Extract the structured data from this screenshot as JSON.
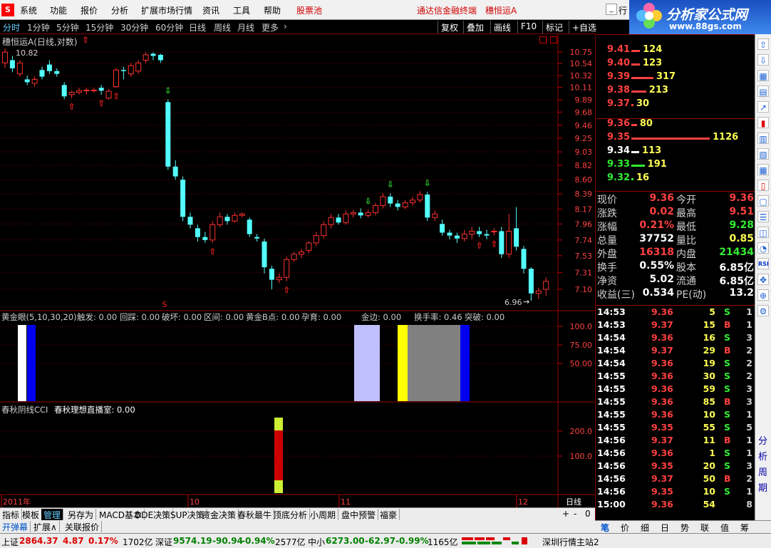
{
  "menu": {
    "logo_letter": "S",
    "items": [
      "系统",
      "功能",
      "报价",
      "分析",
      "扩展市场行情",
      "资讯",
      "工具",
      "帮助"
    ],
    "stock_pool": "股票池",
    "app_title": "通达信金融终端",
    "stock_name": "穗恒运A",
    "right_btn": "行"
  },
  "brand": {
    "name": "分析家公式网",
    "url": "www.88gs.com"
  },
  "timeframes": {
    "items": [
      "分时",
      "1分钟",
      "5分钟",
      "15分钟",
      "30分钟",
      "60分钟",
      "日线",
      "周线",
      "月线",
      "更多"
    ],
    "active": "分时",
    "right_tools": [
      "复权",
      "叠加",
      "画线",
      "F10",
      "标记",
      "+自选"
    ]
  },
  "main_chart": {
    "title": "穗恒运A(日线,对数)",
    "high_label": "10.82",
    "low_label": "6.96",
    "price_axis": [
      "10.75",
      "10.54",
      "10.32",
      "10.11",
      "9.89",
      "9.68",
      "9.46",
      "9.25",
      "9.03",
      "8.82",
      "8.60",
      "8.39",
      "8.17",
      "7.96",
      "7.74",
      "7.53",
      "7.31",
      "7.10"
    ],
    "date_labels": [
      "2011年",
      "10",
      "11",
      "12"
    ],
    "period": "日线"
  },
  "ind1": {
    "name": "黄金眼(5,10,30,20)",
    "items": [
      {
        "label": "触发: 0.00",
        "color": "#ffffff"
      },
      {
        "label": "回踩: 0.00",
        "color": "#ff44ff"
      },
      {
        "label": "破坏: 0.00",
        "color": "#ff44ff"
      },
      {
        "label": "区间: 0.00",
        "color": "#999999"
      },
      {
        "label": "黄金B点: 0.00",
        "color": "#ffff00"
      },
      {
        "label": "孕育: 0.00",
        "color": "#ffffff"
      },
      {
        "label": "金边: 0.00",
        "color": "#ffffff"
      },
      {
        "label": "换手率: 0.46",
        "color": "#ffff00"
      },
      {
        "label": "突破: 0.00",
        "color": "#ff44ff"
      }
    ],
    "axis": [
      "100.0",
      "75.00",
      "50.00"
    ]
  },
  "ind2": {
    "name": "春秋阴线CCI",
    "value": "春秋理想直播室: 0.00",
    "axis": [
      "200.0",
      "100.0"
    ]
  },
  "orderbook": {
    "asks": [
      {
        "price": "9.41",
        "vol": "124"
      },
      {
        "price": "9.40",
        "vol": "123"
      },
      {
        "price": "9.39",
        "vol": "317"
      },
      {
        "price": "9.38",
        "vol": "213"
      },
      {
        "price": "9.37",
        "vol": "30"
      }
    ],
    "bids": [
      {
        "price": "9.36",
        "vol": "80"
      },
      {
        "price": "9.35",
        "vol": "1126"
      },
      {
        "price": "9.34",
        "vol": "113"
      },
      {
        "price": "9.33",
        "vol": "191"
      },
      {
        "price": "9.32",
        "vol": "16"
      }
    ]
  },
  "quote": [
    {
      "l1": "现价",
      "v1": "9.36",
      "l2": "今开",
      "v2": "9.36"
    },
    {
      "l1": "涨跌",
      "v1": "0.02",
      "l2": "最高",
      "v2": "9.51"
    },
    {
      "l1": "涨幅",
      "v1": "0.21%",
      "l2": "最低",
      "v2": "9.28"
    },
    {
      "l1": "总量",
      "v1": "37752",
      "l2": "量比",
      "v2": "0.85"
    },
    {
      "l1": "外盘",
      "v1": "16318",
      "l2": "内盘",
      "v2": "21434"
    },
    {
      "l1": "换手",
      "v1": "0.55%",
      "l2": "股本",
      "v2": "6.85亿"
    },
    {
      "l1": "净资",
      "v1": "5.02",
      "l2": "流通",
      "v2": "6.85亿"
    },
    {
      "l1": "收益(三)",
      "v1": "0.534",
      "l2": "PE(动)",
      "v2": "13.2"
    }
  ],
  "ticks": [
    {
      "t": "14:53",
      "p": "9.36",
      "v": "5",
      "s": "S",
      "n": "1"
    },
    {
      "t": "14:53",
      "p": "9.37",
      "v": "15",
      "s": "B",
      "n": "1"
    },
    {
      "t": "14:54",
      "p": "9.36",
      "v": "16",
      "s": "S",
      "n": "3"
    },
    {
      "t": "14:54",
      "p": "9.37",
      "v": "29",
      "s": "B",
      "n": "2"
    },
    {
      "t": "14:54",
      "p": "9.36",
      "v": "19",
      "s": "S",
      "n": "2"
    },
    {
      "t": "14:55",
      "p": "9.36",
      "v": "30",
      "s": "S",
      "n": "2"
    },
    {
      "t": "14:55",
      "p": "9.36",
      "v": "59",
      "s": "S",
      "n": "3"
    },
    {
      "t": "14:55",
      "p": "9.36",
      "v": "85",
      "s": "B",
      "n": "3"
    },
    {
      "t": "14:55",
      "p": "9.36",
      "v": "10",
      "s": "S",
      "n": "1"
    },
    {
      "t": "14:55",
      "p": "9.35",
      "v": "55",
      "s": "S",
      "n": "5"
    },
    {
      "t": "14:56",
      "p": "9.37",
      "v": "11",
      "s": "B",
      "n": "1"
    },
    {
      "t": "14:56",
      "p": "9.36",
      "v": "1",
      "s": "S",
      "n": "1"
    },
    {
      "t": "14:56",
      "p": "9.35",
      "v": "20",
      "s": "S",
      "n": "3"
    },
    {
      "t": "14:56",
      "p": "9.37",
      "v": "50",
      "s": "B",
      "n": "2"
    },
    {
      "t": "14:56",
      "p": "9.35",
      "v": "10",
      "s": "S",
      "n": "1"
    },
    {
      "t": "15:00",
      "p": "9.36",
      "v": "54",
      "s": "",
      "n": "8"
    }
  ],
  "bottom_tabs": [
    "指标",
    "模板",
    "管理",
    "另存为",
    "MACD基本",
    "DDE决策",
    "SUP决策",
    "资金决策",
    "春秋最牛",
    "顶底分析",
    "小周期",
    "盘中预警",
    "福豪"
  ],
  "bottom_tabs_selected": "管理",
  "bottom_tabs2": [
    "开弹幕",
    "扩展∧",
    "关联报价"
  ],
  "zoom_btns": [
    "+",
    "-",
    "0"
  ],
  "right_tabs": [
    "笔",
    "价",
    "细",
    "日",
    "势",
    "联",
    "值",
    "筹"
  ],
  "status": {
    "sh_label": "上证",
    "sh_val": "2864.37",
    "sh_chg": "4.87",
    "sh_pct": "0.17%",
    "sh_amt": "1702亿",
    "sz_label": "深证",
    "sz_val": "9574.19",
    "sz_chg": "-90.94",
    "sz_pct": "-0.94%",
    "sz_amt": "2577亿",
    "zx_label": "中小",
    "zx_val": "6273.00",
    "zx_chg": "-62.97",
    "zx_pct": "-0.99%",
    "zx_amt": "1165亿",
    "server": "深圳行情主站2"
  },
  "toolbar_icons": [
    "up-arrow-icon",
    "down-arrow-icon",
    "chart-icon",
    "grid-icon",
    "rsi-icon",
    "move-icon",
    "zoom-icon"
  ],
  "right_vtext": [
    "分",
    "析",
    "周",
    "期"
  ],
  "chart_data": {
    "type": "candlestick",
    "candles": [
      [
        10.55,
        10.75,
        10.82,
        10.45
      ],
      [
        10.6,
        10.45,
        10.68,
        10.38
      ],
      [
        10.35,
        10.55,
        10.6,
        10.3
      ],
      [
        10.25,
        10.2,
        10.32,
        10.15
      ],
      [
        10.18,
        10.25,
        10.3,
        10.12
      ],
      [
        10.42,
        10.3,
        10.48,
        10.25
      ],
      [
        10.52,
        10.4,
        10.6,
        10.35
      ],
      [
        10.4,
        10.35,
        10.45,
        10.3
      ],
      [
        10.15,
        9.95,
        10.2,
        9.9
      ],
      [
        9.98,
        10.02,
        10.05,
        9.92
      ],
      [
        10.02,
        10.05,
        10.1,
        9.98
      ],
      [
        10.05,
        10.06,
        10.1,
        9.98
      ],
      [
        10.06,
        10.06,
        10.1,
        10.02
      ],
      [
        10.1,
        10.05,
        10.15,
        9.98
      ],
      [
        9.92,
        10.04,
        10.08,
        9.9
      ],
      [
        10.12,
        10.42,
        10.45,
        10.1
      ],
      [
        10.42,
        10.4,
        10.48,
        10.25
      ],
      [
        10.35,
        10.5,
        10.55,
        10.3
      ],
      [
        10.4,
        10.55,
        10.6,
        10.35
      ],
      [
        10.6,
        10.7,
        10.75,
        10.55
      ],
      [
        10.72,
        10.68,
        10.75,
        10.6
      ],
      [
        10.7,
        10.6,
        10.72,
        10.55
      ],
      [
        9.85,
        8.8,
        9.9,
        8.75
      ],
      [
        8.8,
        8.65,
        8.9,
        8.6
      ],
      [
        8.6,
        8.06,
        8.65,
        8.0
      ],
      [
        8.06,
        7.95,
        8.12,
        7.9
      ],
      [
        7.9,
        7.78,
        7.95,
        7.72
      ],
      [
        7.78,
        7.74,
        7.85,
        7.7
      ],
      [
        7.74,
        7.95,
        8.0,
        7.7
      ],
      [
        7.95,
        8.06,
        8.12,
        7.92
      ],
      [
        8.06,
        8.0,
        8.1,
        7.95
      ],
      [
        8.0,
        8.08,
        8.12,
        7.98
      ],
      [
        8.08,
        8.1,
        8.12,
        8.05
      ],
      [
        8.02,
        7.82,
        8.05,
        7.78
      ],
      [
        7.78,
        7.76,
        7.82,
        7.72
      ],
      [
        7.72,
        7.38,
        7.76,
        7.3
      ],
      [
        7.36,
        7.22,
        7.4,
        7.1
      ],
      [
        7.22,
        7.25,
        7.3,
        7.18
      ],
      [
        7.25,
        7.48,
        7.52,
        7.2
      ],
      [
        7.48,
        7.55,
        7.58,
        7.45
      ],
      [
        7.55,
        7.58,
        7.62,
        7.5
      ],
      [
        7.6,
        7.7,
        7.72,
        7.56
      ],
      [
        7.7,
        7.8,
        7.85,
        7.66
      ],
      [
        7.8,
        7.95,
        8.0,
        7.76
      ],
      [
        7.95,
        8.05,
        8.1,
        7.9
      ],
      [
        8.05,
        7.98,
        8.1,
        7.95
      ],
      [
        7.98,
        8.1,
        8.15,
        7.95
      ],
      [
        8.1,
        8.12,
        8.16,
        8.05
      ],
      [
        8.12,
        8.08,
        8.18,
        8.04
      ],
      [
        8.08,
        8.12,
        8.16,
        8.05
      ],
      [
        8.12,
        8.22,
        8.26,
        8.08
      ],
      [
        8.22,
        8.35,
        8.4,
        8.18
      ],
      [
        8.35,
        8.25,
        8.4,
        8.2
      ],
      [
        8.25,
        8.2,
        8.3,
        8.15
      ],
      [
        8.2,
        8.26,
        8.3,
        8.17
      ],
      [
        8.26,
        8.3,
        8.35,
        8.22
      ],
      [
        8.3,
        8.38,
        8.43,
        8.26
      ],
      [
        8.38,
        8.05,
        8.42,
        8.0
      ],
      [
        8.05,
        8.1,
        8.15,
        8.0
      ],
      [
        7.96,
        7.84,
        8.02,
        7.8
      ],
      [
        7.84,
        7.8,
        7.88,
        7.75
      ],
      [
        7.8,
        7.76,
        7.84,
        7.7
      ],
      [
        7.76,
        7.82,
        7.88,
        7.72
      ],
      [
        7.82,
        7.86,
        7.92,
        7.75
      ],
      [
        7.86,
        7.82,
        7.92,
        7.78
      ],
      [
        7.82,
        7.8,
        7.88,
        7.75
      ],
      [
        7.85,
        7.86,
        7.9,
        7.8
      ],
      [
        7.86,
        7.55,
        7.92,
        7.5
      ],
      [
        7.55,
        7.86,
        8.1,
        7.5
      ],
      [
        7.9,
        7.65,
        8.2,
        7.6
      ],
      [
        7.62,
        7.36,
        7.66,
        7.3
      ],
      [
        7.36,
        7.05,
        7.38,
        6.96
      ],
      [
        7.05,
        7.08,
        7.12,
        6.98
      ],
      [
        7.1,
        7.2,
        7.25,
        7.02
      ]
    ],
    "ymin": 6.96,
    "ymax": 10.82,
    "log_scale": true
  }
}
